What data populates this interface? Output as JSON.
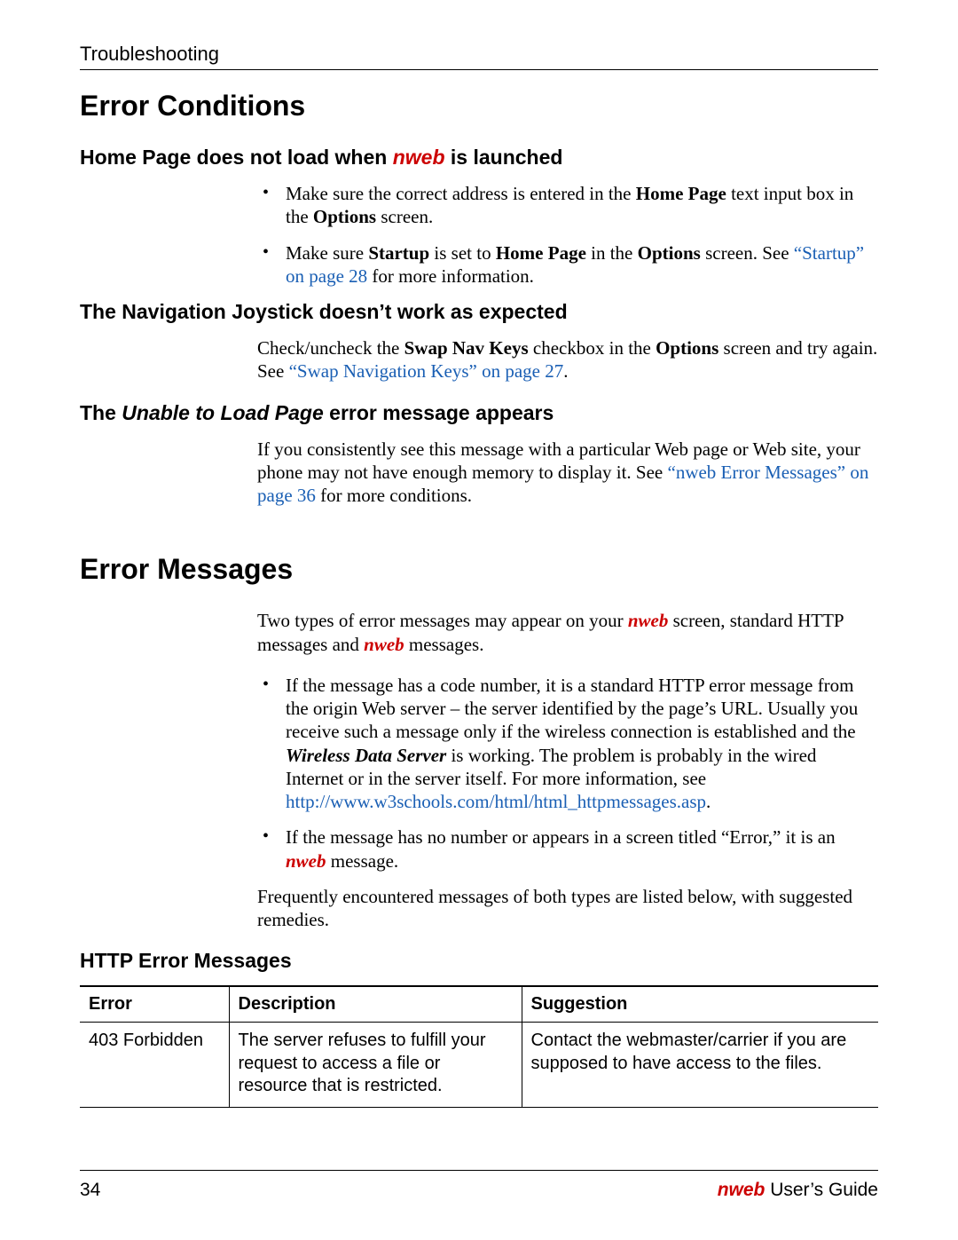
{
  "header": {
    "chapter": "Troubleshooting"
  },
  "section1": {
    "title": "Error Conditions",
    "sub1": {
      "prefix": "Home Page does not load when ",
      "nweb": "nweb",
      "suffix": " is launched",
      "bullet1_a": "Make sure the correct address is entered in the ",
      "bullet1_b": "Home Page",
      "bullet1_c": " text input box in the ",
      "bullet1_d": "Options",
      "bullet1_e": " screen.",
      "bullet2_a": "Make sure ",
      "bullet2_b": "Startup",
      "bullet2_c": " is set to ",
      "bullet2_d": "Home Page",
      "bullet2_e": " in the ",
      "bullet2_f": "Options",
      "bullet2_g": " screen. See ",
      "bullet2_link": "“Startup” on page 28",
      "bullet2_h": " for more information."
    },
    "sub2": {
      "title": "The Navigation Joystick doesn’t work as expected",
      "p_a": "Check/uncheck the ",
      "p_b": "Swap Nav Keys",
      "p_c": " checkbox in the ",
      "p_d": "Options",
      "p_e": " screen and try again. See ",
      "p_link": "“Swap Navigation Keys” on page 27",
      "p_f": "."
    },
    "sub3": {
      "prefix": "The ",
      "italic": "Unable to Load Page",
      "suffix": " error message appears",
      "p_a": "If you consistently see this message with a particular Web page or Web site, your phone may not have enough memory to display it. See ",
      "p_link": "“nweb Error Messages” on page 36",
      "p_b": " for more conditions."
    }
  },
  "section2": {
    "title": "Error Messages",
    "intro_a": "Two types of error messages may appear on your ",
    "intro_nweb1": "nweb",
    "intro_b": " screen, standard HTTP messages and ",
    "intro_nweb2": "nweb",
    "intro_c": " messages.",
    "bullet1_a": "If the message has a code number, it is a standard HTTP error message from the origin Web server – the server identified by the page’s URL. Usually you receive such a message only if the wireless connection is established and the ",
    "bullet1_b": "Wireless Data Server",
    "bullet1_c": " is working. The problem is probably in the wired Internet or in the server itself. For more information, see ",
    "bullet1_link": "http://www.w3schools.com/html/html_httpmessages.asp",
    "bullet1_d": ".",
    "bullet2_a": "If the message has no number or appears in a screen titled “Error,” it is an ",
    "bullet2_nweb": "nweb",
    "bullet2_b": " message.",
    "outro": "Frequently encountered messages of both types are listed below, with suggested remedies.",
    "sub_http": "HTTP Error Messages",
    "table": {
      "h1": "Error",
      "h2": "Description",
      "h3": "Suggestion",
      "rows": [
        {
          "err": "403 Forbidden",
          "desc": "The server refuses to fulfill your request to access a file or resource that is restricted.",
          "sug": "Contact the webmaster/carrier if you are supposed to have access to the files."
        }
      ]
    }
  },
  "footer": {
    "page": "34",
    "nweb": "nweb",
    "guide": " User’s Guide"
  }
}
